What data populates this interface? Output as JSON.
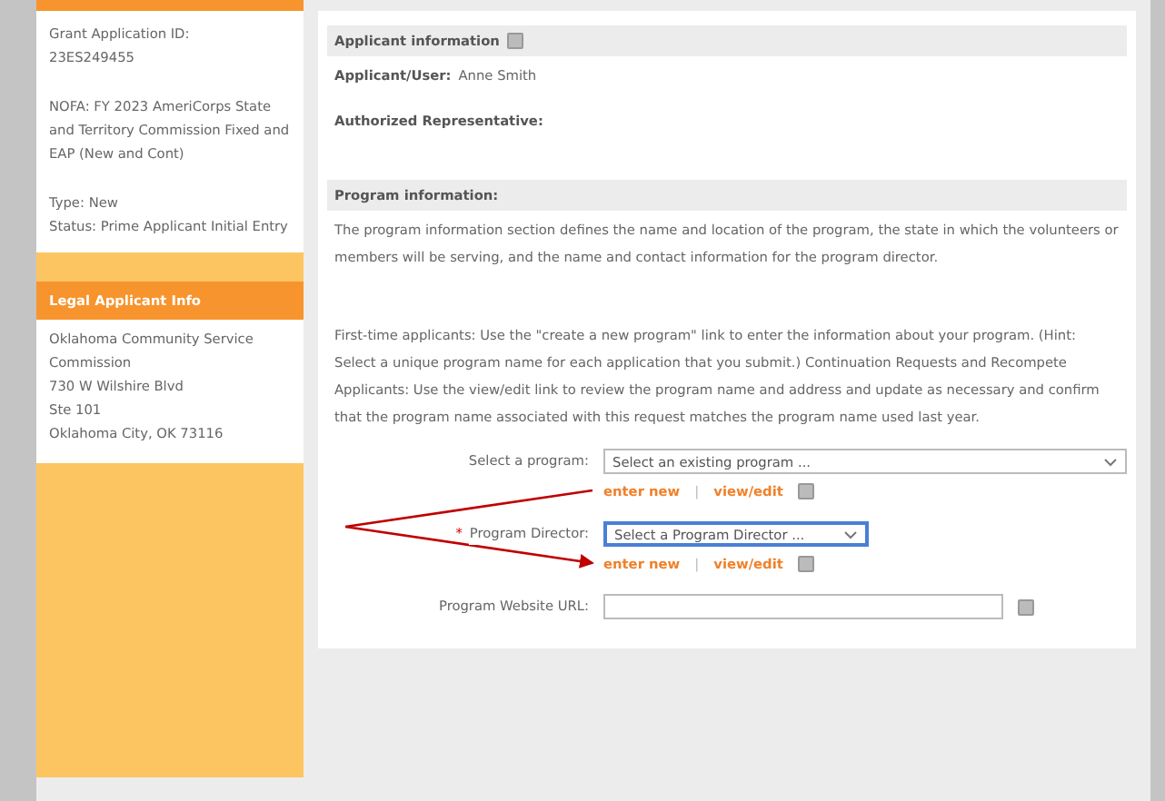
{
  "sidebar": {
    "summary_groups": [
      [
        "Grant Application ID:",
        "23ES249455"
      ],
      [
        "NOFA: FY 2023 AmeriCorps State and Territory Commission Fixed and EAP (New and Cont)"
      ],
      [
        "Type: New",
        "Status: Prime Applicant Initial Entry"
      ]
    ],
    "legal_header": "Legal Applicant Info",
    "legal_lines": [
      "Oklahoma Community Service Commission",
      "730 W Wilshire Blvd",
      "Ste 101",
      "Oklahoma City, OK 73116"
    ]
  },
  "applicant": {
    "title": "Applicant information",
    "fields": [
      {
        "label": "Applicant/User:",
        "value": "Anne Smith"
      },
      {
        "label": "Authorized Representative:"
      }
    ]
  },
  "program": {
    "title": "Program information:",
    "intro": "The program information section defines the name and location of the program, the state in which the volunteers or members will be serving, and the name and contact information for the program director.",
    "instructions": "First-time applicants: Use the \"create a new program\" link to enter the information about your program. (Hint: Select a unique program name for each application that you submit.) Continuation Requests and Recompete Applicants: Use the view/edit link to review the program name and address and update as necessary and confirm that the program name associated with this request matches the program name used last year.",
    "fields": [
      {
        "kind": "select",
        "label": "Select a program:",
        "required": false,
        "value": "Select an existing program ...",
        "focused": false,
        "links": [
          "enter new",
          "view/edit"
        ],
        "separator": "|"
      },
      {
        "kind": "select",
        "label": "Program Director:",
        "required": true,
        "required_mark": "*",
        "value": "Select a Program Director ...",
        "focused": true,
        "links": [
          "enter new",
          "view/edit"
        ],
        "separator": "|"
      },
      {
        "kind": "text",
        "label": "Program Website URL:",
        "required": false,
        "focused": false
      }
    ]
  }
}
